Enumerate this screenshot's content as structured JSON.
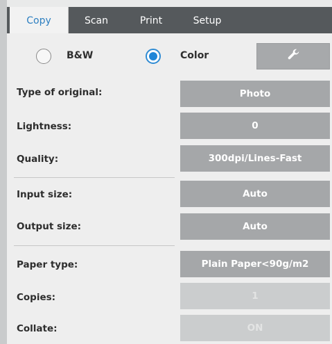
{
  "tabs": [
    {
      "label": "Copy",
      "active": true
    },
    {
      "label": "Scan",
      "active": false
    },
    {
      "label": "Print",
      "active": false
    },
    {
      "label": "Setup",
      "active": false
    }
  ],
  "color_mode": {
    "options": [
      {
        "label": "B&W",
        "selected": false
      },
      {
        "label": "Color",
        "selected": true
      }
    ],
    "tool_icon": "wrench-icon"
  },
  "settings": {
    "type_of_original": {
      "label": "Type of original:",
      "value": "Photo"
    },
    "lightness": {
      "label": "Lightness:",
      "value": "0"
    },
    "quality": {
      "label": "Quality:",
      "value": "300dpi/Lines-Fast"
    },
    "input_size": {
      "label": "Input size:",
      "value": "Auto"
    },
    "output_size": {
      "label": "Output size:",
      "value": "Auto"
    },
    "paper_type": {
      "label": "Paper type:",
      "value": "Plain Paper<90g/m2"
    },
    "copies": {
      "label": "Copies:",
      "value": "1",
      "disabled": true
    },
    "collate": {
      "label": "Collate:",
      "value": "ON",
      "disabled": true
    }
  },
  "colors": {
    "tab_bar": "#55595c",
    "active_tab_text": "#2d7fc1",
    "value_button": "#a5a7a9",
    "disabled_button": "#cbcdce",
    "radio_selected": "#1f86d8"
  }
}
